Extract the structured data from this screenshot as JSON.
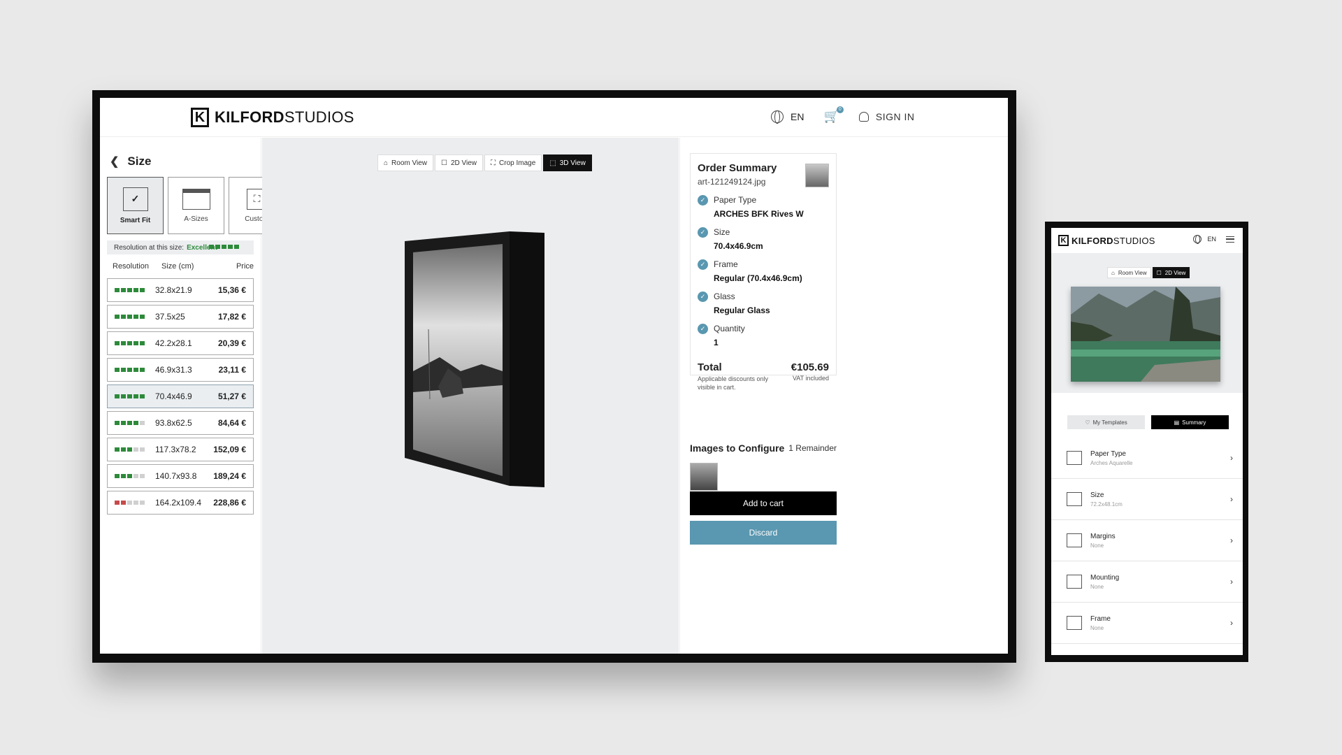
{
  "brand": {
    "mark": "K",
    "name_bold": "KILFORD",
    "name_light": "STUDIOS"
  },
  "header": {
    "lang": "EN",
    "cart_count": "0",
    "signin": "SIGN IN"
  },
  "left": {
    "title": "Size",
    "modes": [
      {
        "label": "Smart Fit",
        "icon": "check-icon"
      },
      {
        "label": "A-Sizes",
        "icon": "a-sizes-icon"
      },
      {
        "label": "Custom",
        "icon": "custom-icon"
      }
    ],
    "resolution_label": "Resolution at this size:",
    "resolution_value": "Excellent",
    "columns": [
      "Resolution",
      "Size (cm)",
      "Price"
    ],
    "rows": [
      {
        "size": "32.8x21.9",
        "price": "15,36 €",
        "quality": 5
      },
      {
        "size": "37.5x25",
        "price": "17,82 €",
        "quality": 5
      },
      {
        "size": "42.2x28.1",
        "price": "20,39 €",
        "quality": 5
      },
      {
        "size": "46.9x31.3",
        "price": "23,11 €",
        "quality": 5
      },
      {
        "size": "70.4x46.9",
        "price": "51,27 €",
        "quality": 5,
        "selected": true
      },
      {
        "size": "93.8x62.5",
        "price": "84,64 €",
        "quality": 4
      },
      {
        "size": "117.3x78.2",
        "price": "152,09 €",
        "quality": 3
      },
      {
        "size": "140.7x93.8",
        "price": "189,24 €",
        "quality": 3
      },
      {
        "size": "164.2x109.4",
        "price": "228,86 €",
        "quality": 2,
        "low": true
      }
    ]
  },
  "view_tabs": [
    "Room View",
    "2D View",
    "Crop Image",
    "3D View"
  ],
  "active_tab": "3D View",
  "summary": {
    "title": "Order Summary",
    "file": "art-121249124.jpg",
    "items": [
      {
        "label": "Paper Type",
        "value": "ARCHES BFK Rives W"
      },
      {
        "label": "Size",
        "value": "70.4x46.9cm"
      },
      {
        "label": "Frame",
        "value": "Regular (70.4x46.9cm)"
      },
      {
        "label": "Glass",
        "value": "Regular Glass"
      },
      {
        "label": "Quantity",
        "value": "1"
      }
    ],
    "total_label": "Total",
    "total_value": "€105.69",
    "discount_note": "Applicable discounts only visible in cart.",
    "vat_note": "VAT included"
  },
  "configure": {
    "title": "Images to Configure",
    "remainder": "1 Remainder",
    "add": "Add to cart",
    "discard": "Discard"
  },
  "mobile": {
    "lang": "EN",
    "tabs": [
      "Room View",
      "2D View"
    ],
    "toggle": [
      "My Templates",
      "Summary"
    ],
    "items": [
      {
        "title": "Paper Type",
        "sub": "Arches Aquarelle"
      },
      {
        "title": "Size",
        "sub": "72.2x48.1cm"
      },
      {
        "title": "Margins",
        "sub": "None"
      },
      {
        "title": "Mounting",
        "sub": "None"
      },
      {
        "title": "Frame",
        "sub": "None"
      }
    ]
  },
  "colors": {
    "accent": "#5a97b0",
    "good": "#2d8a3a",
    "bad": "#c74a4a"
  }
}
